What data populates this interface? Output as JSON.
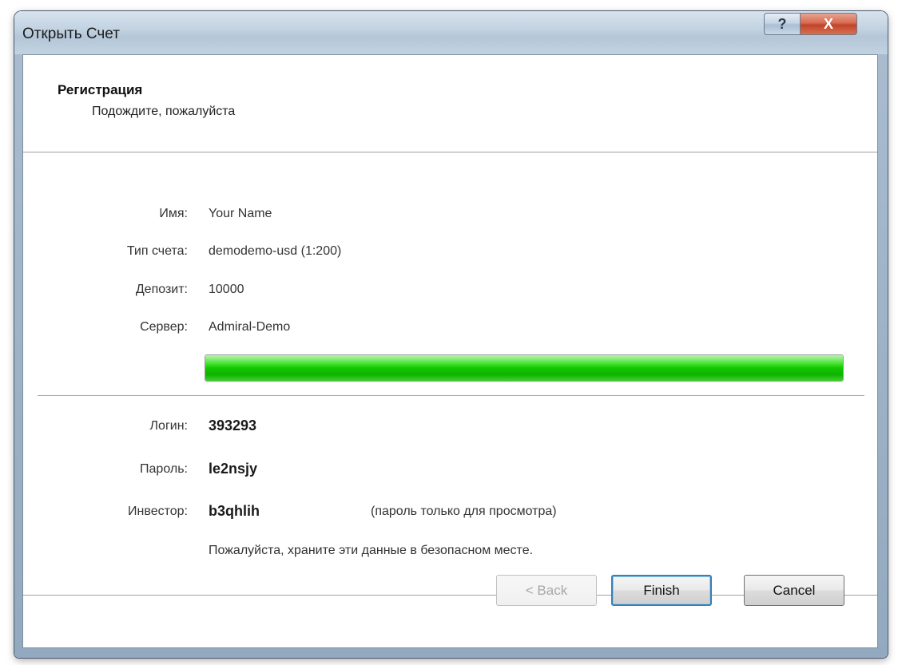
{
  "window": {
    "title": "Открыть Счет",
    "help_glyph": "?",
    "close_glyph": "X"
  },
  "header": {
    "title": "Регистрация",
    "subtitle": "Подождите, пожалуйста"
  },
  "account": {
    "name_label": "Имя:",
    "name_value": "Your Name",
    "type_label": "Тип счета:",
    "type_value": "demodemo-usd (1:200)",
    "deposit_label": "Депозит:",
    "deposit_value": "10000",
    "server_label": "Сервер:",
    "server_value": "Admiral-Demo"
  },
  "progress": {
    "percent": 100,
    "color": "#12c800"
  },
  "credentials": {
    "login_label": "Логин:",
    "login_value": "393293",
    "password_label": "Пароль:",
    "password_value": "le2nsjy",
    "investor_label": "Инвестор:",
    "investor_value": "b3qhlih",
    "investor_note": "(пароль только для просмотра)",
    "safety_note": "Пожалуйста, храните эти данные в безопасном месте."
  },
  "buttons": {
    "back": "< Back",
    "finish": "Finish",
    "cancel": "Cancel"
  }
}
